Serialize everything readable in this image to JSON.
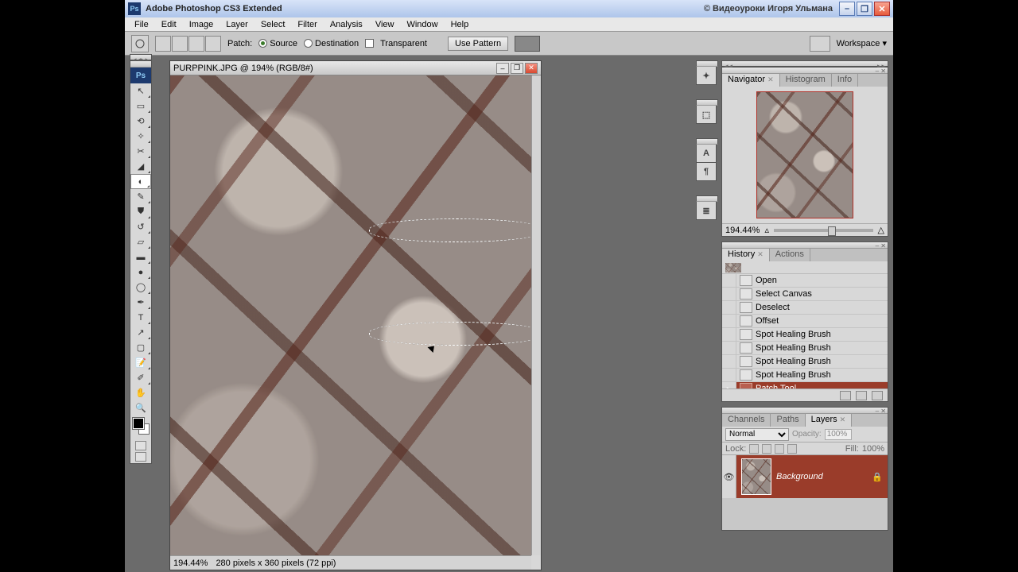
{
  "titlebar": {
    "app": "Adobe Photoshop CS3 Extended",
    "credits": "© Видеоуроки Игоря Ульмана",
    "badge": "Ps"
  },
  "menu": [
    "File",
    "Edit",
    "Image",
    "Layer",
    "Select",
    "Filter",
    "Analysis",
    "View",
    "Window",
    "Help"
  ],
  "options": {
    "label": "Patch:",
    "source": "Source",
    "destination": "Destination",
    "transparent": "Transparent",
    "use_pattern": "Use Pattern",
    "workspace": "Workspace ▾"
  },
  "document": {
    "title": "PURPPINK.JPG @ 194% (RGB/8#)",
    "zoom": "194.44%",
    "status": "280 pixels x 360 pixels (72 ppi)"
  },
  "navigator": {
    "tabs": [
      "Navigator",
      "Histogram",
      "Info"
    ],
    "zoom": "194.44%"
  },
  "history": {
    "tabs": [
      "History",
      "Actions"
    ],
    "items": [
      "Open",
      "Select Canvas",
      "Deselect",
      "Offset",
      "Spot Healing Brush",
      "Spot Healing Brush",
      "Spot Healing Brush",
      "Spot Healing Brush",
      "Patch Tool"
    ]
  },
  "layers": {
    "tabs": [
      "Channels",
      "Paths",
      "Layers"
    ],
    "blend": "Normal",
    "opacity_label": "Opacity:",
    "opacity": "100%",
    "lock_label": "Lock:",
    "fill_label": "Fill:",
    "fill": "100%",
    "layer_name": "Background"
  },
  "strip_icons": [
    "✦",
    "⬚",
    "A",
    "¶",
    "≣"
  ]
}
